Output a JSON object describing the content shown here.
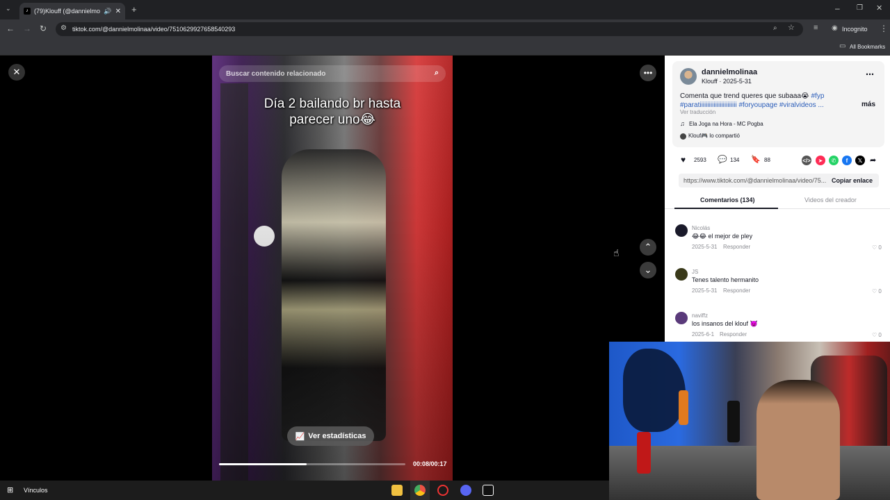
{
  "browser": {
    "tab_title": "(79)Klouff (@dannielmolina",
    "url": "tiktok.com/@dannielmolinaa/video/7510629927658540293",
    "profile_label": "Incognito",
    "bookmarks_label": "All Bookmarks"
  },
  "video": {
    "search_placeholder": "Buscar contenido relacionado",
    "caption_line1": "Día 2 bailando br hasta",
    "caption_line2": "parecer uno😂",
    "stats_button": "Ver estadísticas",
    "time": "00:08/00:17",
    "progress": 0.47
  },
  "post": {
    "username": "dannielmolinaa",
    "nickname_date": "Klouff · 2025-5-31",
    "description_text": "Comenta que trend queres que subaaa😭",
    "hashtag_fyp": "#fyp",
    "hashtags_line2": "#paratiiiiiiiiiiiiiiiiiiiiiiii #foryoupage #viralvideos ...",
    "more_label": "más",
    "translate_label": "Ver traducción",
    "music": "Ela Joga na Hora - MC Pogba",
    "shared_by": "Klouf🎮 lo compartió",
    "likes": "2593",
    "comments": "134",
    "saves": "88",
    "link": "https://www.tiktok.com/@dannielmolinaa/video/75...",
    "copy_link": "Copiar enlace",
    "tab_comments": "Comentarios (134)",
    "tab_creator": "Videos del creador",
    "reply_label": "Responder"
  },
  "comments": [
    {
      "name": "Nicolás",
      "text": "😂😂 el mejor de pley",
      "date": "2025-5-31",
      "likes": "0",
      "color": "#1a1a2a"
    },
    {
      "name": "JS",
      "text": "Tenes talento hermanito",
      "date": "2025-5-31",
      "likes": "0",
      "color": "#3a3a1a"
    },
    {
      "name": "naviffz",
      "text": "los insanos del klouf 👿",
      "date": "2025-6-1",
      "likes": "0",
      "color": "#5a3a7a"
    }
  ],
  "taskbar": {
    "vinculos": "Vínculos"
  },
  "colors": {
    "chrome_dark": "#202124",
    "tiktok_link": "#2b5db9",
    "whatsapp": "#25d366",
    "facebook": "#1877f2"
  }
}
